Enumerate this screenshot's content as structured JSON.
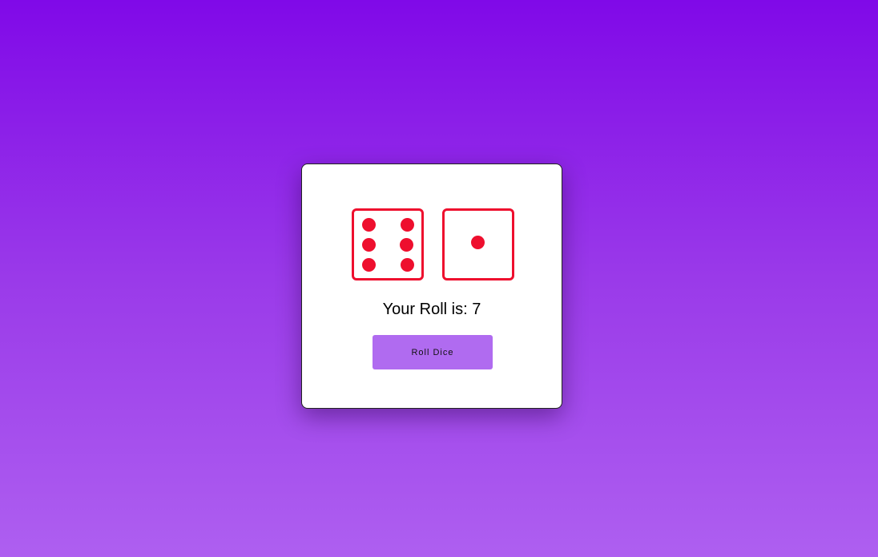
{
  "dice": [
    {
      "value": 6,
      "color": "#ee0f2e"
    },
    {
      "value": 1,
      "color": "#ee0f2e"
    }
  ],
  "result": {
    "label": "Your Roll is:",
    "total": "7"
  },
  "roll_button": {
    "label": "Roll Dice",
    "color": "#b06bf0"
  },
  "background": {
    "gradient_top": "#8009e8",
    "gradient_bottom": "#ae5ff0"
  }
}
